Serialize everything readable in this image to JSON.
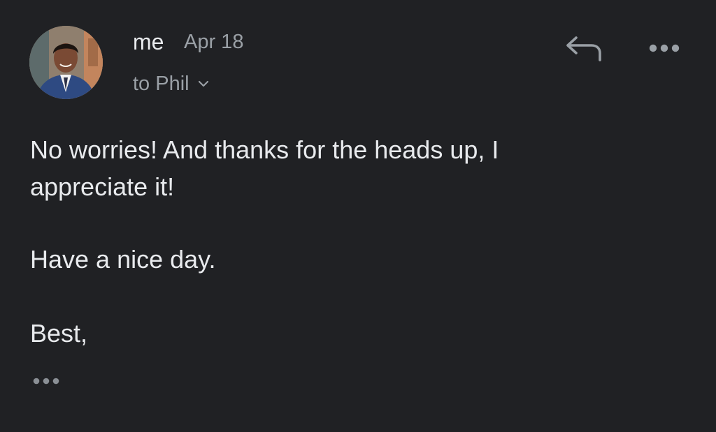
{
  "message": {
    "sender": "me",
    "date": "Apr 18",
    "recipient_label": "to Phil",
    "body": {
      "line1": "No worries! And thanks for the heads up, I",
      "line2": "appreciate it!",
      "line3": "Have a nice day.",
      "line4": "Best,"
    }
  },
  "icons": {
    "avatar": "avatar",
    "recipient_expand": "chevron-down-icon",
    "reply": "reply-icon",
    "more": "more-options-icon",
    "trimmed": "ellipsis-icon"
  },
  "colors": {
    "background": "#202124",
    "primary_text": "#e8eaed",
    "secondary_text": "#9aa0a6"
  }
}
